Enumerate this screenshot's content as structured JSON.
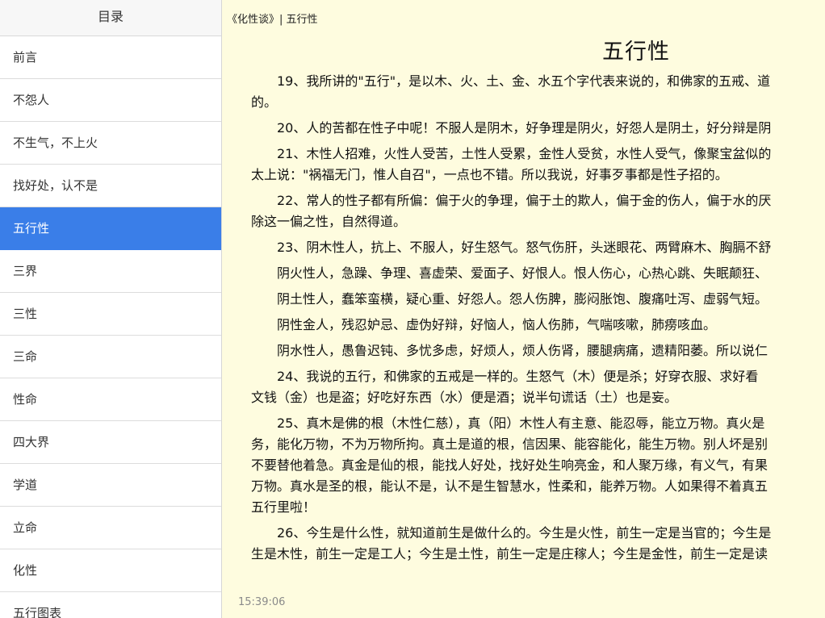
{
  "sidebar": {
    "header": "目录",
    "items": [
      {
        "label": "前言"
      },
      {
        "label": "不怨人"
      },
      {
        "label": "不生气，不上火"
      },
      {
        "label": "找好处，认不是"
      },
      {
        "label": "五行性",
        "active": true
      },
      {
        "label": "三界"
      },
      {
        "label": "三性"
      },
      {
        "label": "三命"
      },
      {
        "label": "性命"
      },
      {
        "label": "四大界"
      },
      {
        "label": "学道"
      },
      {
        "label": "立命"
      },
      {
        "label": "化性"
      },
      {
        "label": "五行图表"
      }
    ],
    "active_color": "#3a7ee8"
  },
  "reader": {
    "breadcrumb": "《化性谈》| 五行性",
    "title": "五行性",
    "background": "#fefcdf",
    "paragraphs": [
      "19、我所讲的\"五行\"，是以木、火、土、金、水五个字代表来说的，和佛家的五戒、道\n的。",
      "20、人的苦都在性子中呢！不服人是阴木，好争理是阴火，好怨人是阴土，好分辩是阴",
      "21、木性人招难，火性人受苦，土性人受累，金性人受贫，水性人受气，像聚宝盆似的\n太上说：\"祸福无门，惟人自召\"，一点也不错。所以我说，好事歹事都是性子招的。",
      "22、常人的性子都有所偏：偏于火的争理，偏于土的欺人，偏于金的伤人，偏于水的厌\n除这一偏之性，自然得道。",
      "23、阴木性人，抗上、不服人，好生怒气。怒气伤肝，头迷眼花、两臂麻木、胸膈不舒",
      "阴火性人，急躁、争理、喜虚荣、爱面子、好恨人。恨人伤心，心热心跳、失眠颠狂、",
      "阴土性人，蠢笨蛮横，疑心重、好怨人。怨人伤脾，膨闷胀饱、腹痛吐泻、虚弱气短。",
      "阴性金人，残忍妒忌、虚伪好辩，好恼人，恼人伤肺，气喘咳嗽，肺痨咳血。",
      "阴水性人，愚鲁迟钝、多忧多虑，好烦人，烦人伤肾，腰腿病痛，遗精阳萎。所以说仁",
      "24、我说的五行，和佛家的五戒是一样的。生怒气（木）便是杀；好穿衣服、求好看\n文钱（金）也是盗；好吃好东西（水）便是酒；说半句谎话（土）也是妄。",
      "25、真木是佛的根（木性仁慈），真（阳）木性人有主意、能忍辱，能立万物。真火是\n务，能化万物，不为万物所拘。真土是道的根，信因果、能容能化，能生万物。别人坏是别\n不要替他着急。真金是仙的根，能找人好处，找好处生响亮金，和人聚万缘，有义气，有果\n万物。真水是圣的根，能认不是，认不是生智慧水，性柔和，能养万物。人如果得不着真五\n五行里啦！",
      "26、今生是什么性，就知道前生是做什么的。今生是火性，前生一定是当官的；今生是\n生是木性，前生一定是工人；今生是土性，前生一定是庄稼人；今生是金性，前生一定是读"
    ],
    "clock": "15:39:06"
  }
}
